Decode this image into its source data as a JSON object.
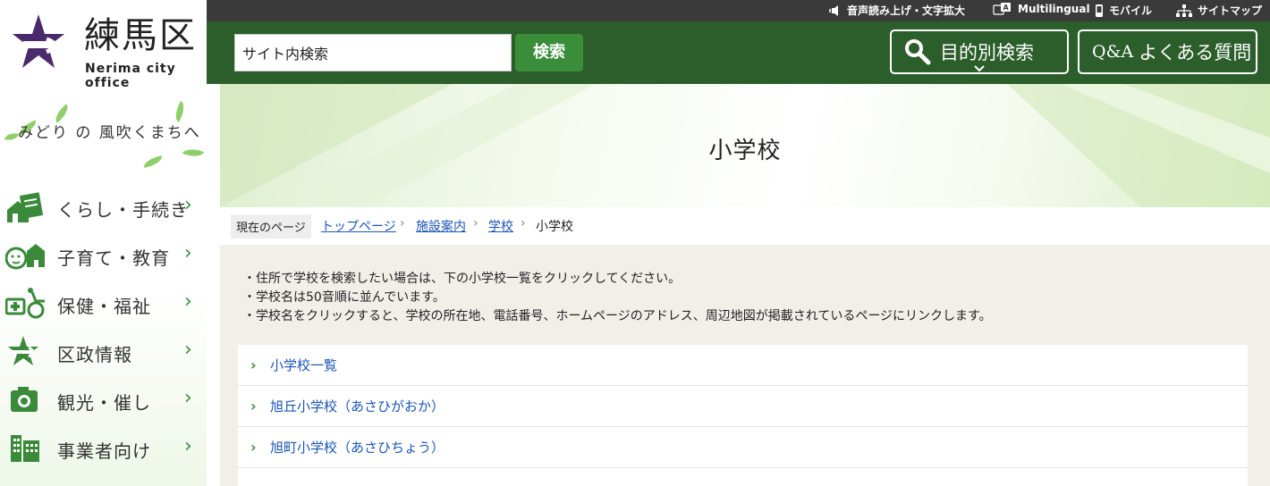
{
  "logo": {
    "title": "練馬区",
    "subtitle": "Nerima city office"
  },
  "tagline": "みどり の 風吹くまちへ",
  "nav": [
    {
      "label": "くらし・手続き",
      "icon": "house-document-icon"
    },
    {
      "label": "子育て・教育",
      "icon": "child-school-icon"
    },
    {
      "label": "保健・福祉",
      "icon": "health-wheelchair-icon"
    },
    {
      "label": "区政情報",
      "icon": "city-emblem-icon"
    },
    {
      "label": "観光・催し",
      "icon": "camera-icon"
    },
    {
      "label": "事業者向け",
      "icon": "building-icon"
    }
  ],
  "utilbar": {
    "voice": "音声読み上げ・文字拡大",
    "multilingual": "Multilingual",
    "mobile": "モバイル",
    "sitemap": "サイトマップ"
  },
  "header": {
    "search_value": "サイト内検索",
    "search_button": "検索",
    "purpose_search": "目的別検索",
    "qa_prefix": "Q&A",
    "qa_label": "よくある質問"
  },
  "page": {
    "title": "小学校",
    "breadcrumb_here": "現在のページ",
    "breadcrumb": [
      "トップページ",
      "施設案内",
      "学校"
    ],
    "breadcrumb_current": "小学校"
  },
  "notes": [
    "・住所で学校を検索したい場合は、下の小学校一覧をクリックしてください。",
    "・学校名は50音順に並んでいます。",
    "・学校名をクリックすると、学校の所在地、電話番号、ホームページのアドレス、周辺地図が掲載されているページにリンクします。"
  ],
  "schools": [
    "小学校一覧",
    "旭丘小学校（あさひがおか）",
    "旭町小学校（あさひちょう）"
  ],
  "colors": {
    "header_green": "#2b5e2b",
    "nav_green": "#3a8a3a",
    "link_blue": "#1a55b8",
    "logo_purple": "#4b2a6b"
  }
}
